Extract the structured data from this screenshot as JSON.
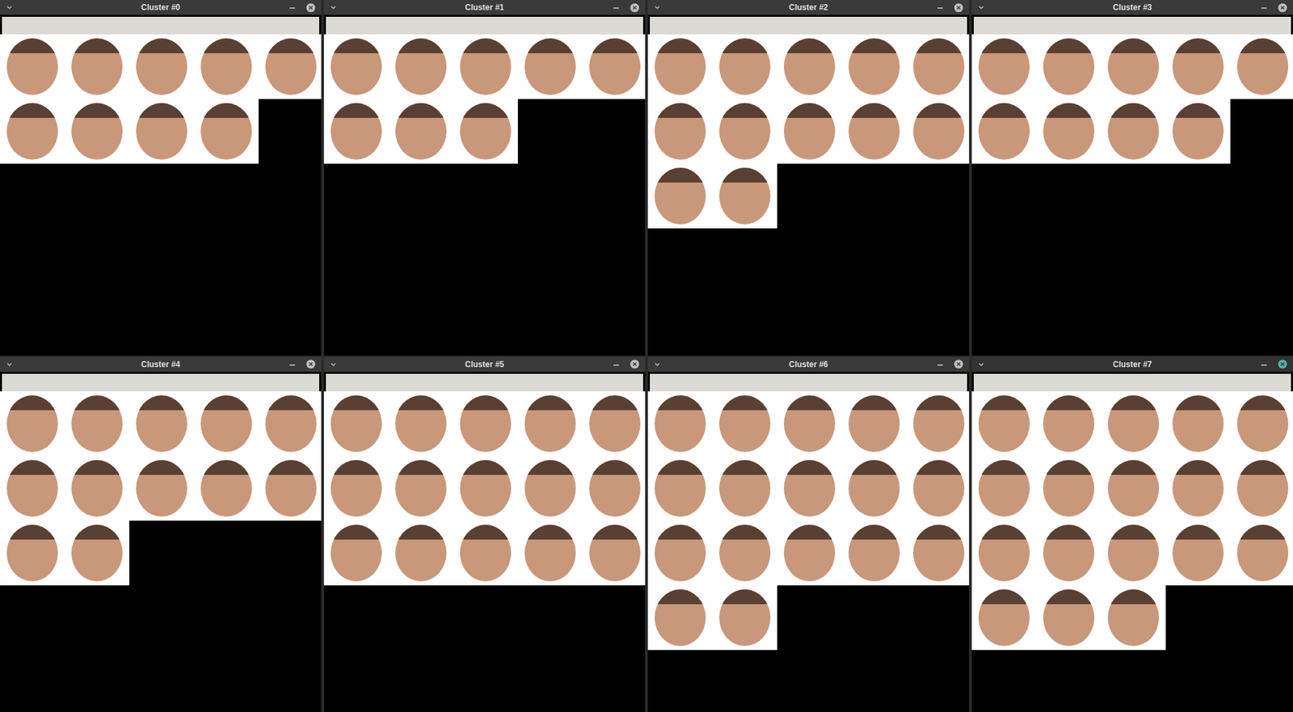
{
  "windows": [
    {
      "title": "Cluster #0",
      "photo_count": 9,
      "focused": false
    },
    {
      "title": "Cluster #1",
      "photo_count": 8,
      "focused": false
    },
    {
      "title": "Cluster #2",
      "photo_count": 12,
      "focused": false
    },
    {
      "title": "Cluster #3",
      "photo_count": 9,
      "focused": false
    },
    {
      "title": "Cluster #4",
      "photo_count": 12,
      "focused": false
    },
    {
      "title": "Cluster #5",
      "photo_count": 15,
      "focused": false
    },
    {
      "title": "Cluster #6",
      "photo_count": 17,
      "focused": false
    },
    {
      "title": "Cluster #7",
      "photo_count": 18,
      "focused": true
    }
  ]
}
